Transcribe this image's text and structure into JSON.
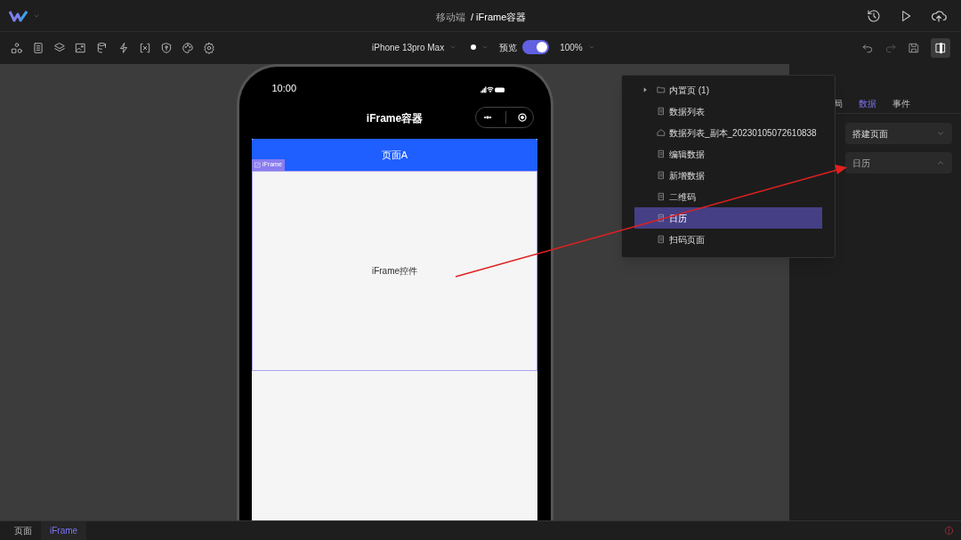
{
  "header": {
    "breadcrumb": [
      "移动端",
      "/ iFrame容器"
    ]
  },
  "toolbar": {
    "device": "iPhone 13pro Max",
    "preview_label": "预览",
    "preview_on": true,
    "zoom": "100%"
  },
  "phone": {
    "time": "10:00",
    "title": "iFrame容器",
    "header_text": "页面A",
    "tag": "iFrame",
    "content": "iFrame控件"
  },
  "page_menu": [
    {
      "kind": "folder",
      "label": "内置页 (1)",
      "selected": false
    },
    {
      "kind": "page",
      "label": "数据列表",
      "selected": false
    },
    {
      "kind": "home",
      "label": "数据列表_副本_20230105072610838",
      "selected": false
    },
    {
      "kind": "page",
      "label": "编辑数据",
      "selected": false
    },
    {
      "kind": "page",
      "label": "新增数据",
      "selected": false
    },
    {
      "kind": "page",
      "label": "二维码",
      "selected": false
    },
    {
      "kind": "page",
      "label": "日历",
      "selected": true
    },
    {
      "kind": "page",
      "label": "扫码页面",
      "selected": false
    }
  ],
  "panel": {
    "tabs": [
      {
        "label": "局",
        "selected": false
      },
      {
        "label": "数据",
        "selected": true
      },
      {
        "label": "事件",
        "selected": false
      }
    ],
    "selects": [
      {
        "value": "搭建页面",
        "expanded": false
      },
      {
        "value": "日历",
        "expanded": true
      }
    ]
  },
  "status_bar": {
    "crumbs": [
      {
        "label": "页面",
        "selected": false
      },
      {
        "label": "iFrame",
        "selected": true
      }
    ]
  }
}
